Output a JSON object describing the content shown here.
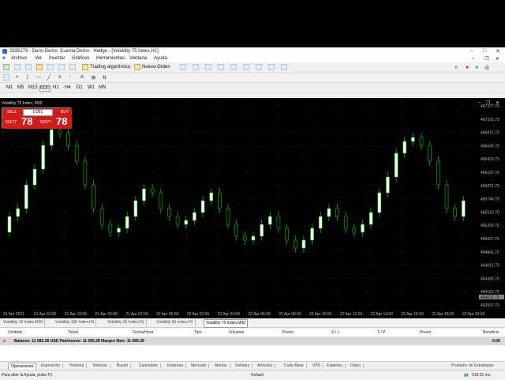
{
  "window": {
    "title": "2835179 - Deriv-Demo: Cuenta Demo - Hedge - [Volatility 75 Index,H1]"
  },
  "menu": [
    "Archivo",
    "Ver",
    "Insertar",
    "Gráficos",
    "Herramientas",
    "Ventana",
    "Ayuda"
  ],
  "toolbar": {
    "algo_label": "Trading algorítmico",
    "order_label": "Nueva Orden"
  },
  "timeframes": [
    "M1",
    "M5",
    "M15",
    "M30",
    "H1",
    "H4",
    "D1",
    "W1",
    "MN"
  ],
  "chart": {
    "window_label": "Volatility 75 Index, M30",
    "one_click": {
      "sell_label": "SELL",
      "buy_label": "BUY",
      "lot": "0.001",
      "sell_small": "53177",
      "sell_big": "78",
      "buy_small": "53377",
      "buy_big": "78"
    },
    "price_labels": [
      "467327.70",
      "467101.70",
      "466875.70",
      "466649.70",
      "466423.70",
      "466197.70",
      "465971.70",
      "465745.70",
      "465519.70",
      "465293.70",
      "465067.70",
      "464841.70",
      "464615.70",
      "464389.70",
      "464163.70",
      "463937.70"
    ],
    "current_price": "464032.73",
    "time_labels": [
      "21 Apr 2021",
      "21 Apr 16:00",
      "21 Apr 18:00",
      "21 Apr 20:00",
      "21 Apr 22:00",
      "22 Apr 00:00",
      "22 Apr 02:00",
      "22 Apr 04:00",
      "22 Apr 06:00",
      "22 Apr 08:00",
      "22 Apr 10:00",
      "22 Apr 12:00",
      "22 Apr 14:00",
      "22 Apr 16:00",
      "22 Apr 18:00",
      "22 Apr 20:00"
    ],
    "colors": {
      "bull": "#ffffff",
      "bear": "#000000",
      "wick": "#00cc00",
      "grid": "#3a3a3a"
    }
  },
  "chart_tabs": [
    "Volatility 10 Index,M30",
    "Volatility 100 Index,H1",
    "Volatility 25 Index,H1",
    "Volatility 50 Index,H1",
    "Volatility 75 Index,M30"
  ],
  "terminal": {
    "columns": [
      "Símbolo",
      "Ticket",
      "Fecha/Hora",
      "Tipo",
      "Volumen",
      "Precio",
      "S / L",
      "T / P",
      "Precio",
      "Beneficio"
    ],
    "balance_text": "Balance: 11 685.28 USD  Patrimonio: 11 685.28  Margen libre: 11 685.28",
    "balance_profit": "0.00",
    "tabs": [
      "Operaciones",
      "Exposición",
      "Historial",
      "Noticias",
      "Buzón",
      "Calendario",
      "Empresa",
      "Mercado",
      "Alertas",
      "Señales",
      "Artículos",
      "Code Base",
      "VPS",
      "Expertos",
      "Diario"
    ],
    "strategy_tester": "Probador de Estrategias"
  },
  "status": {
    "help": "Para abrir la Ayuda, pulse F1",
    "profile": "Default",
    "traffic": "218.01 ms"
  }
}
